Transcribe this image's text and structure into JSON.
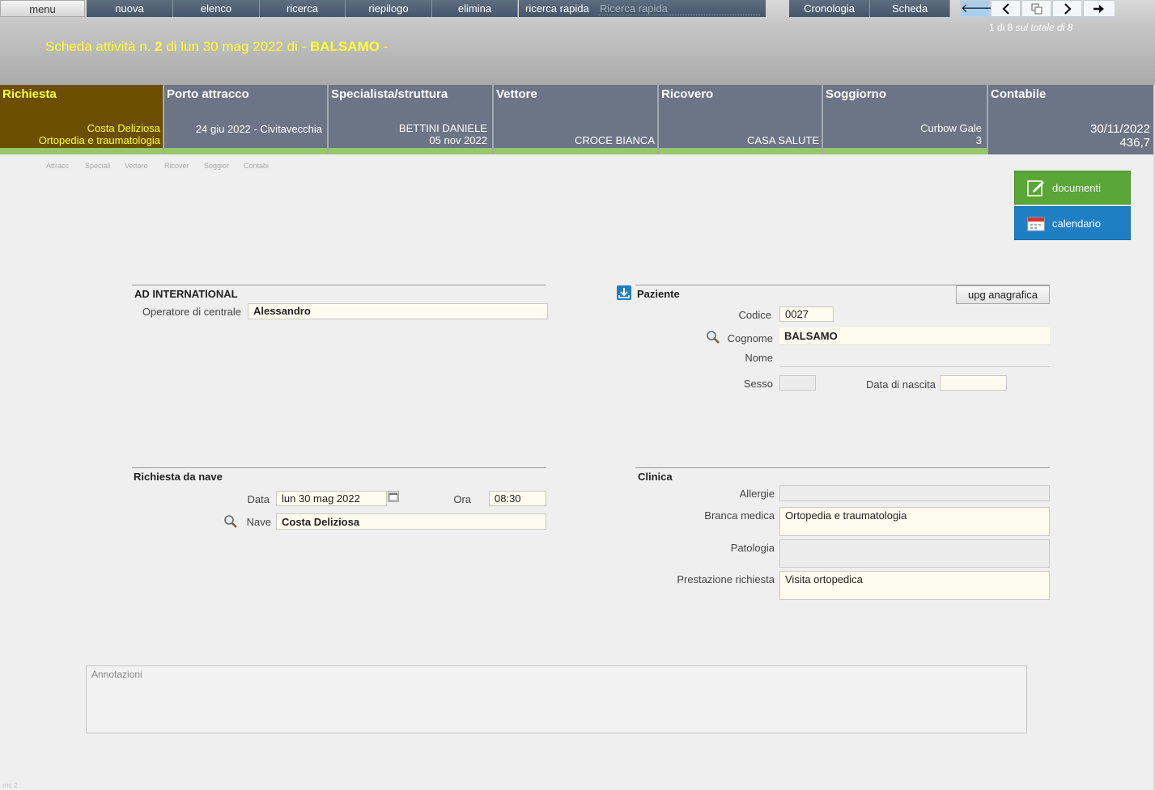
{
  "toolbar": {
    "menu": "menu",
    "nuova": "nuova",
    "elenco": "elenco",
    "ricerca": "ricerca",
    "riepilogo": "riepilogo",
    "elimina": "elimina",
    "quick_search_label": "ricerca rapida",
    "quick_search_placeholder": "Ricerca rapida",
    "cronologia": "Cronologia",
    "scheda": "Scheda",
    "icons": [
      "arrow-left-bold-icon",
      "chevron-left-icon",
      "copy-icon",
      "chevron-right-icon",
      "arrow-right-bold-icon"
    ]
  },
  "counter": {
    "current": "1 di 8",
    "total": "sul totale di 8"
  },
  "title": {
    "prefix": "Scheda attività n. ",
    "number": "2",
    "middle": " di lun 30 mag 2022 di  - ",
    "name": "BALSAMO",
    "suffix": "  -"
  },
  "tabs": [
    {
      "title": "Richiesta",
      "line1": "Costa Deliziosa",
      "line2": "Ortopedia e traumatologia"
    },
    {
      "title": "Porto attracco",
      "line1": "24 giu 2022  -  Civitavecchia",
      "line2": ""
    },
    {
      "title": "Specialista/struttura",
      "line1": "BETTINI DANIELE",
      "line2": "05 nov 2022"
    },
    {
      "title": "Vettore",
      "line1": "",
      "line2": "CROCE BIANCA"
    },
    {
      "title": "Ricovero",
      "line1": "",
      "line2": "CASA SALUTE"
    },
    {
      "title": "Soggiorno",
      "line1": "Curbow Gale",
      "line2": "3"
    },
    {
      "title": "Contabile",
      "line1": "30/11/2022",
      "line2": "436,7"
    }
  ],
  "mini_tabs": [
    "Attracc",
    "Speciali",
    "Vettore",
    "Ricover",
    "Soggior",
    "Contabi"
  ],
  "actions": {
    "documenti": "documenti",
    "calendario": "calendario"
  },
  "agency": {
    "title": "AD INTERNATIONAL",
    "operator_label": "Operatore di centrale",
    "operator_value": "Alessandro"
  },
  "patient": {
    "title": "Paziente",
    "upg_button": "upg anagrafica",
    "codice_label": "Codice",
    "codice_value": "0027",
    "cognome_label": "Cognome",
    "cognome_value": "BALSAMO",
    "nome_label": "Nome",
    "nome_value": "",
    "sesso_label": "Sesso",
    "sesso_value": "",
    "nascita_label": "Data di nascita",
    "nascita_value": ""
  },
  "ship_request": {
    "title": "Richiesta da nave",
    "data_label": "Data",
    "data_value": "lun 30 mag 2022",
    "ora_label": "Ora",
    "ora_value": "08:30",
    "nave_label": "Nave",
    "nave_value": "Costa Deliziosa"
  },
  "clinic": {
    "title": "Clinica",
    "allergie_label": "Allergie",
    "allergie_value": "",
    "branca_label": "Branca medica",
    "branca_value": "Ortopedia e traumatologia",
    "patologia_label": "Patologia",
    "patologia_value": "",
    "prestazione_label": "Prestazione richiesta",
    "prestazione_value": "Visita ortopedica"
  },
  "notes": {
    "label": "Annotazioni",
    "value": ""
  },
  "footer": {
    "code": "rrrc 2"
  },
  "colors": {
    "tab_bg": "#6b7585",
    "tab_active_bg": "#6b4e00",
    "tab_bar": "#96c76b",
    "title_yellow": "#ffff33",
    "documenti_bg": "#5aa636",
    "calendario_bg": "#1f7ec4"
  }
}
